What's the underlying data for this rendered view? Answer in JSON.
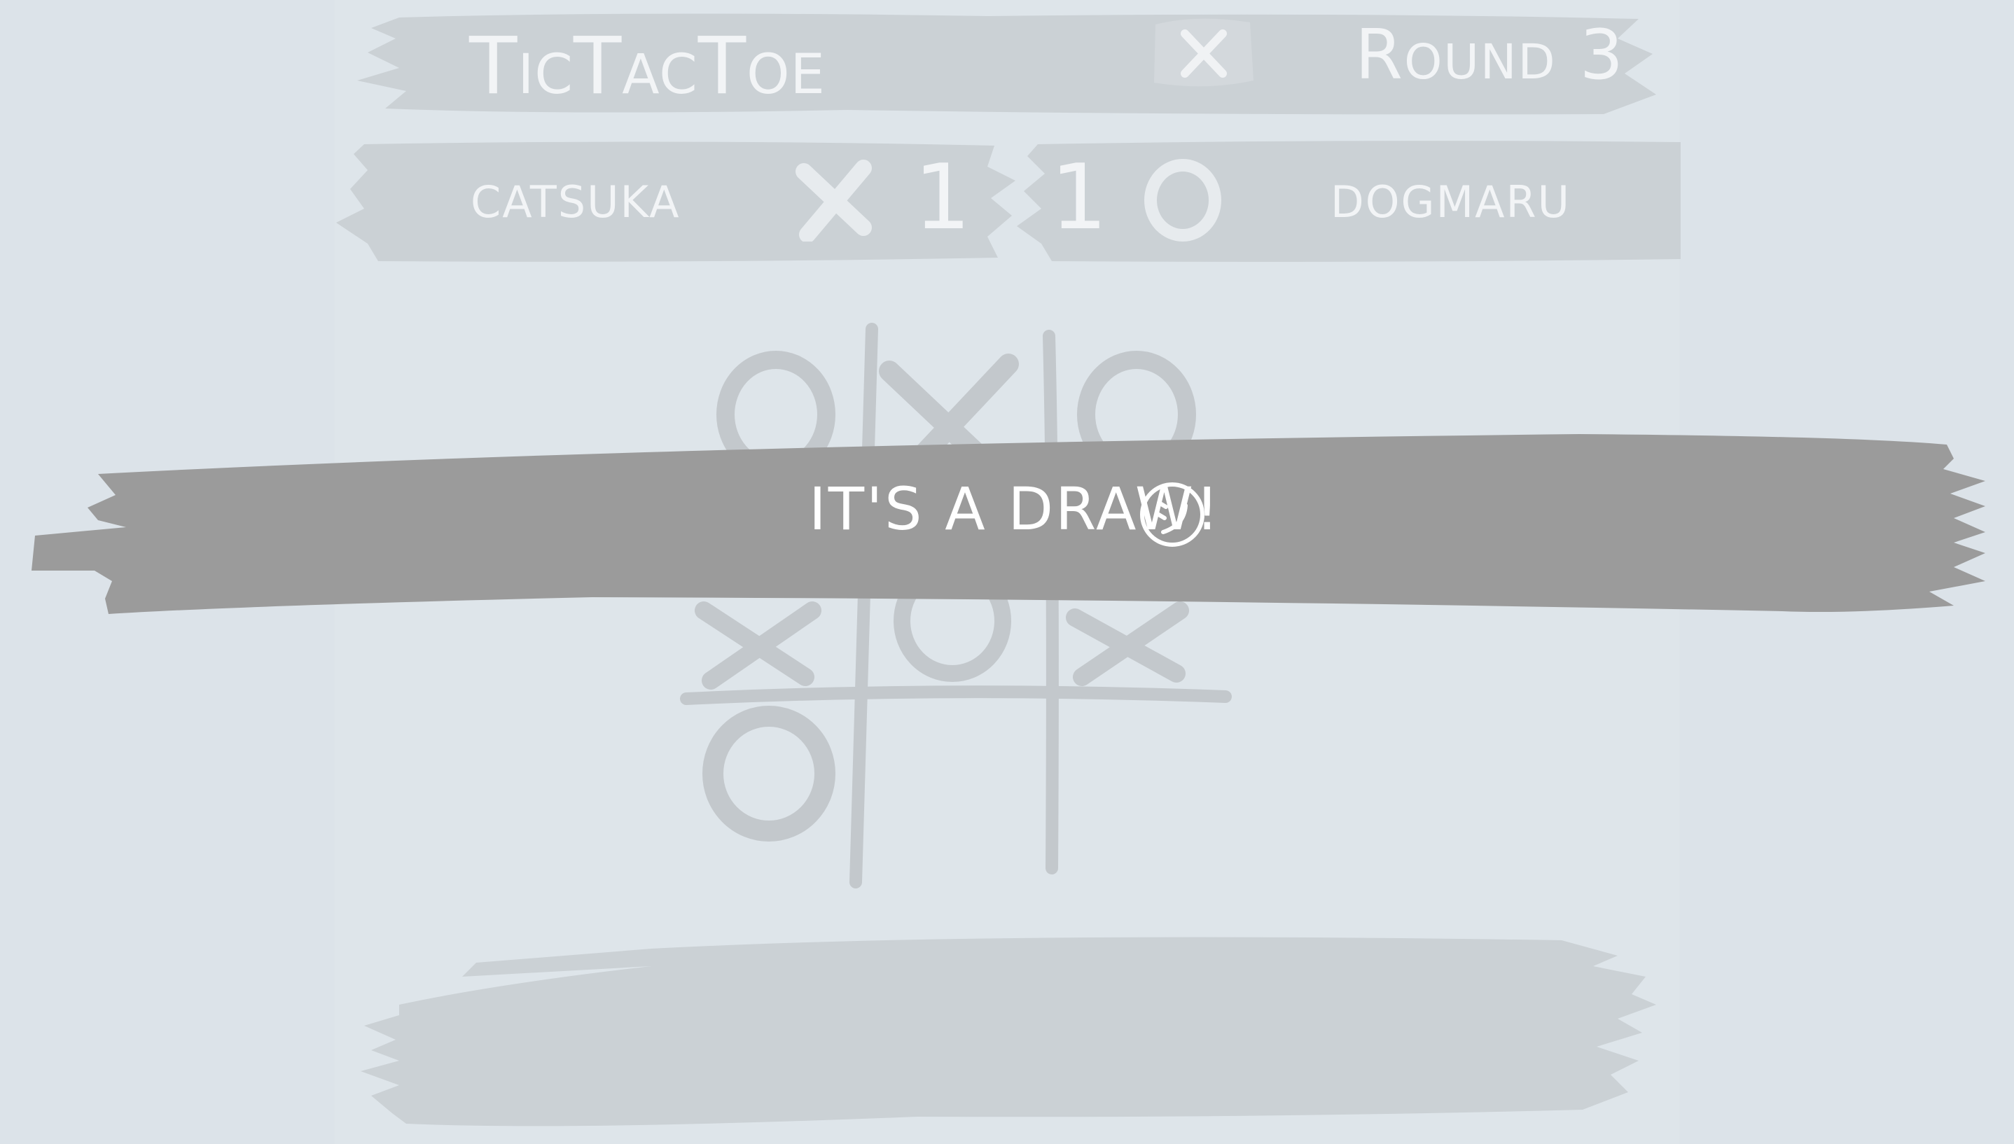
{
  "header": {
    "title": "TicTacToe",
    "round": "Round 3",
    "close_icon": "close-x-icon"
  },
  "scoreboard": {
    "player1": {
      "name": "CATSUKA",
      "mark": "X",
      "score": "1"
    },
    "player2": {
      "name": "DOGMARU",
      "mark": "O",
      "score": "1"
    }
  },
  "board": {
    "cells": [
      "O",
      "X",
      "O",
      "X",
      "O",
      "X",
      "O",
      "",
      ""
    ]
  },
  "result": {
    "message": "IT'S A DRAW!",
    "emoji_icon": "smiley-face-icon"
  },
  "colors": {
    "background": "#dce3e9",
    "brush_light": "#cbd1d5",
    "banner": "#9b9b9b",
    "text_light": "#f2f4f6",
    "board_marks": "#c3c8cc"
  }
}
